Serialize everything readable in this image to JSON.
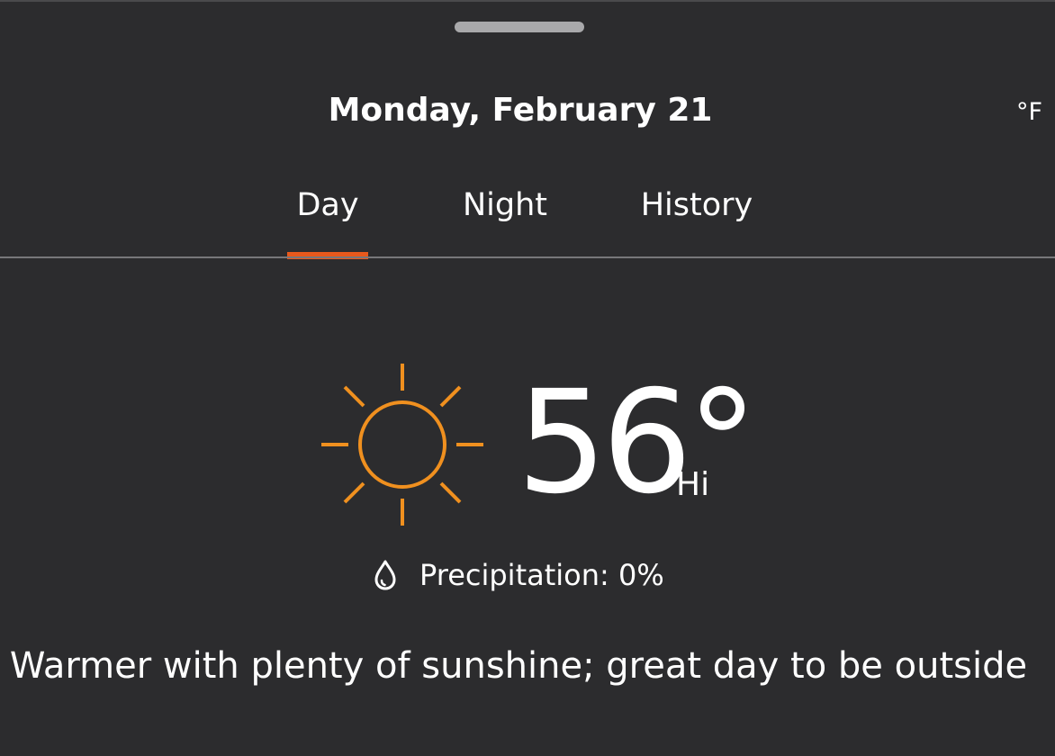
{
  "header": {
    "date_title": "Monday, February 21",
    "unit_toggle": "°F"
  },
  "tabs": [
    {
      "label": "Day",
      "selected": true
    },
    {
      "label": "Night",
      "selected": false
    },
    {
      "label": "History",
      "selected": false
    }
  ],
  "forecast": {
    "icon": "sun-icon",
    "temperature": "56°",
    "temperature_label": "Hi",
    "precipitation_icon": "raindrop-icon",
    "precipitation": "Precipitation: 0%",
    "summary": "Warmer with plenty of sunshine; great day to be outside"
  },
  "colors": {
    "background": "#2c2c2e",
    "accent": "#e8591c",
    "sun": "#f0901f",
    "text": "#ffffff"
  }
}
